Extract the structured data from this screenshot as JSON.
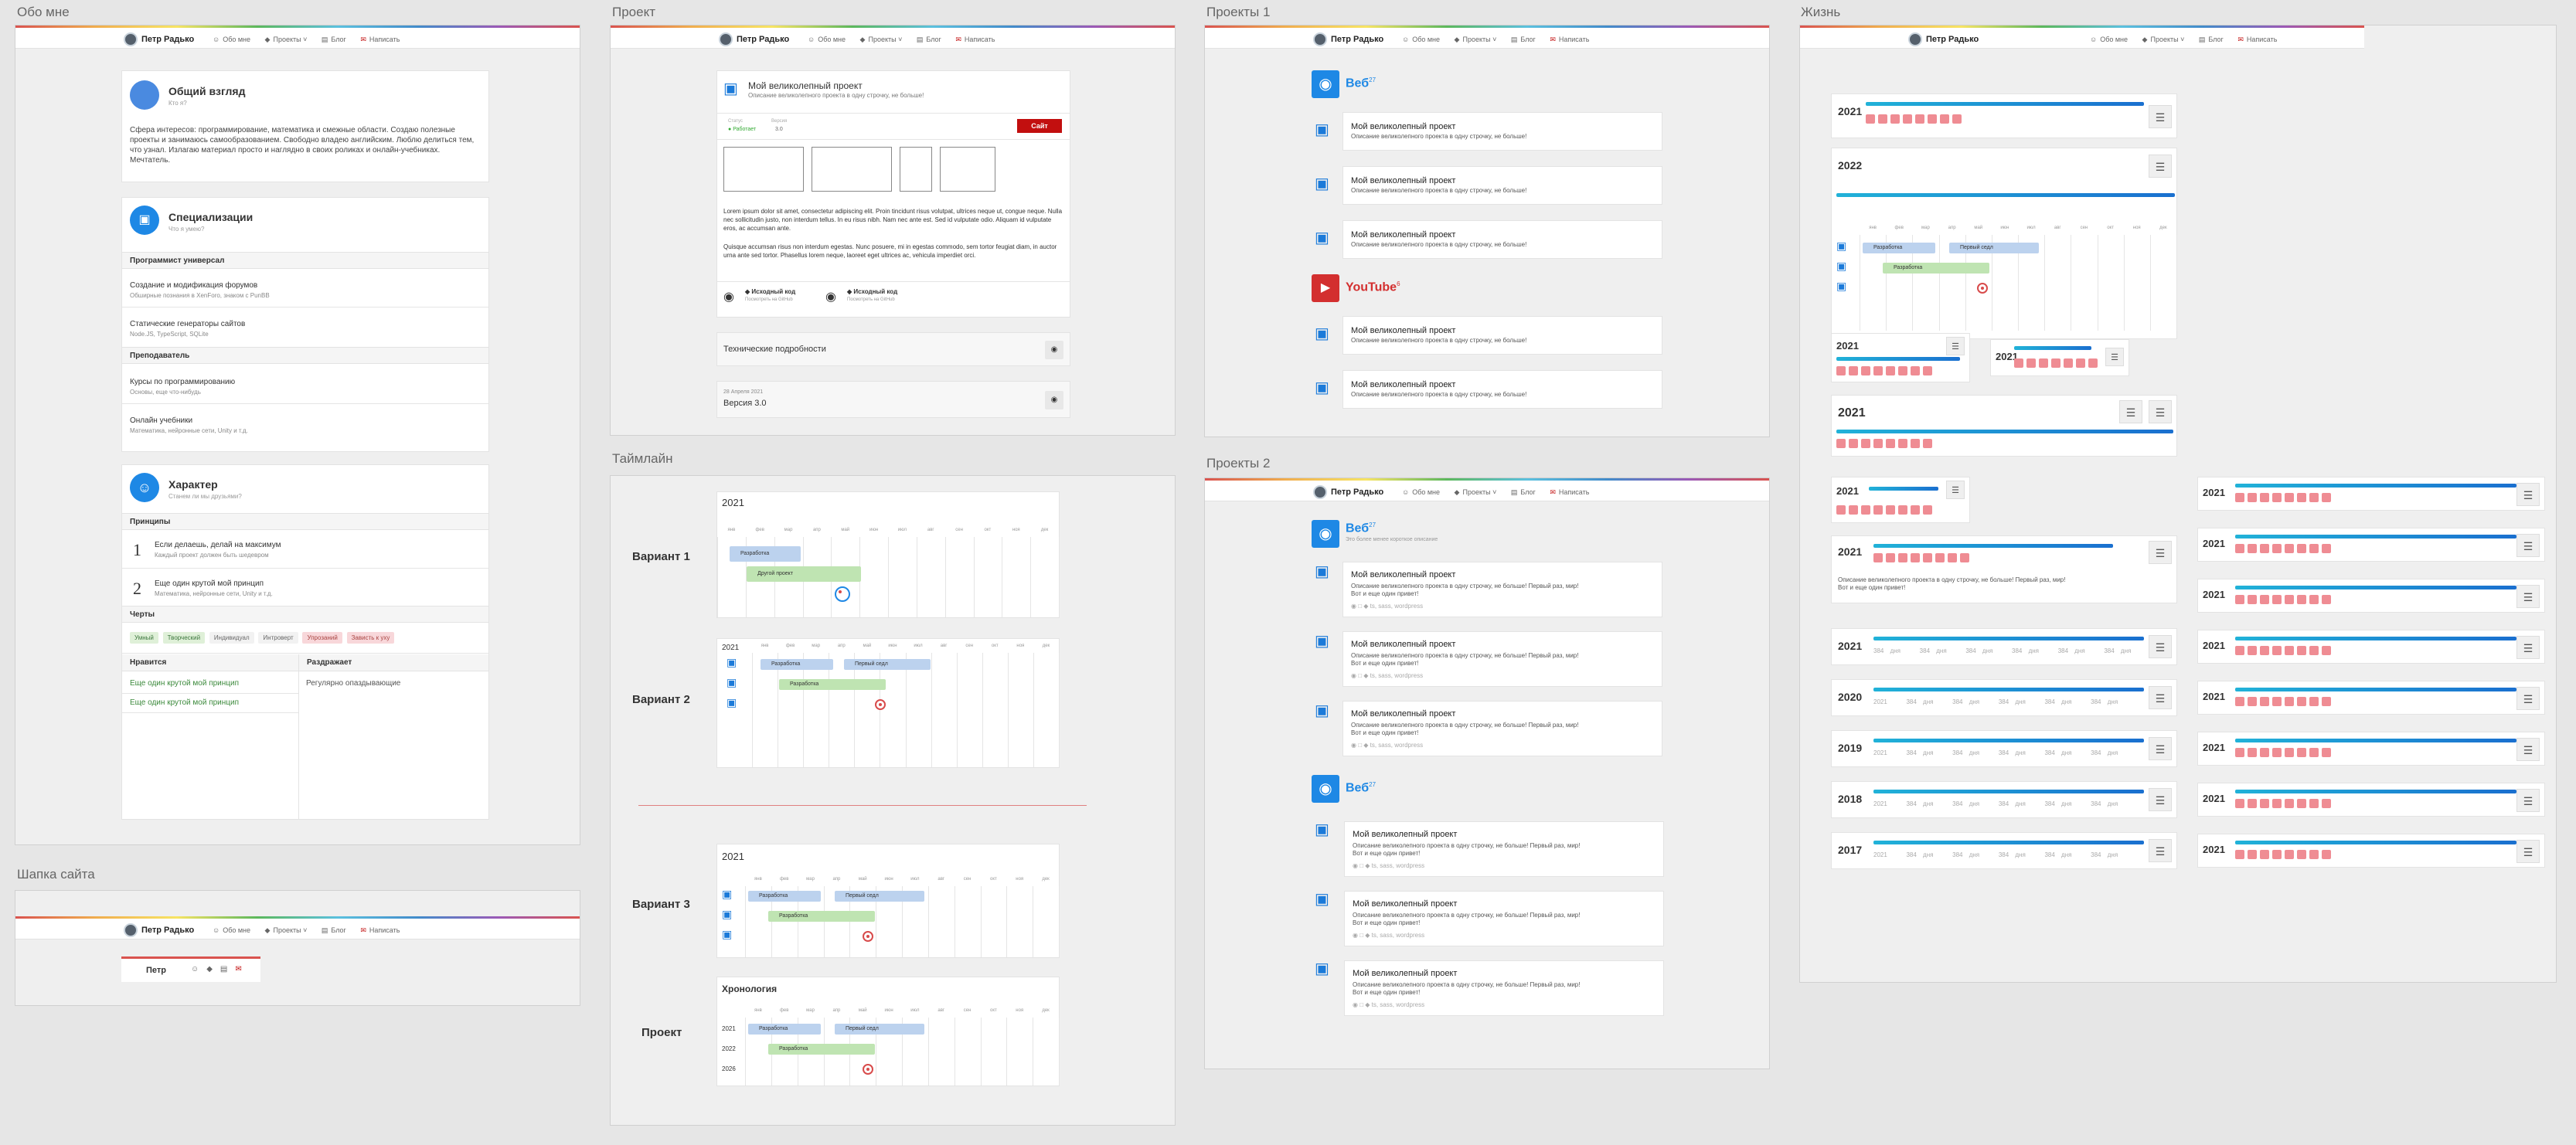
{
  "frames": {
    "about": "Обо мне",
    "header": "Шапка сайта",
    "project": "Проект",
    "timeline": "Таймлайн",
    "projects1": "Проекты 1",
    "projects2": "Проекты 2",
    "life": "Жизнь"
  },
  "site_header": {
    "name": "Петр Радько",
    "nav": [
      "Обо мне",
      "Проекты",
      "Блог",
      "Написать"
    ],
    "short_name": "Петр"
  },
  "about": {
    "overview": {
      "title": "Общий взгляд",
      "subtitle": "Кто я?",
      "text": "Сфера интересов: программирование, математика и смежные области. Создаю полезные проекты и занимаюсь самообразованием. Свободно владею английским. Люблю делиться тем, что узнал. Излагаю материал просто и наглядно в своих роликах и онлайн-учебниках. Мечтатель."
    },
    "spec": {
      "title": "Специализации",
      "subtitle": "Что я умею?",
      "group1": "Программист универсал",
      "items1": [
        {
          "t": "Создание и модификация форумов",
          "s": "Обширные познания в XenForo, знаком с PunBB"
        },
        {
          "t": "Статические генераторы сайтов",
          "s": "Node.JS, TypeScript, SQLite"
        }
      ],
      "group2": "Преподаватель",
      "items2": [
        {
          "t": "Курсы по программированию",
          "s": "Основы, еще что-нибудь"
        },
        {
          "t": "Онлайн учебники",
          "s": "Математика, нейронные сети, Unity и т.д."
        }
      ]
    },
    "character": {
      "title": "Характер",
      "subtitle": "Станем ли мы друзьями?",
      "principles_label": "Принципы",
      "principles": [
        {
          "n": "1",
          "t": "Если делаешь, делай на максимум",
          "s": "Каждый проект должен быть шедевром"
        },
        {
          "n": "2",
          "t": "Еще один крутой мой принцип",
          "s": "Математика, нейронные сети, Unity и т.д."
        }
      ],
      "traits_label": "Черты",
      "traits": [
        "Умный",
        "Творческий",
        "Индивидуал",
        "Интроверт",
        "Упрозаний",
        "Зависть к уху"
      ],
      "likes_label": "Нравится",
      "dislikes_label": "Раздражает",
      "likes": [
        "Еще один крутой мой принцип",
        "Еще один крутой мой принцип"
      ],
      "dislikes": [
        "Регулярно опаздывающие"
      ]
    }
  },
  "project": {
    "title": "Мой великолепный проект",
    "desc": "Описание великолепного проекта в одну строчку, не больше!",
    "status_label": "Статус",
    "status": "Работает",
    "version_label": "Версия",
    "version": "3.0",
    "site_btn": "Сайт",
    "body1": "Lorem ipsum dolor sit amet, consectetur adipiscing elit. Proin tincidunt risus volutpat, ultrices neque ut, congue neque. Nulla nec sollicitudin justo, non interdum tellus. In eu risus nibh. Nam nec ante est. Sed id vulputate odio. Aliquam id vulputate eros, ac accumsan ante.",
    "body2": "Quisque accumsan risus non interdum egestas. Nunc posuere, mi in egestas commodo, sem tortor feugiat diam, in auctor urna ante sed tortor. Phasellus lorem neque, laoreet eget ultrices ac, vehicula imperdiet orci.",
    "src_label": "Исходный код",
    "src_sub": "Посмотреть на GitHub",
    "tech": "Технические подробности",
    "date": "28 Апреля 2021",
    "version_title": "Версия 3.0"
  },
  "timeline": {
    "variants": [
      "Вариант 1",
      "Вариант 2",
      "Вариант 3",
      "Проект"
    ],
    "year": "2021",
    "months": [
      "янв",
      "фев",
      "мар",
      "апр",
      "май",
      "июн",
      "июл",
      "авг",
      "сен",
      "окт",
      "ноя",
      "дек"
    ],
    "bar1": "Разработка",
    "bar2": "Другой проект",
    "bar3": "Первый седл",
    "chronology": "Хронология",
    "years": [
      "2021",
      "2022",
      "2026"
    ]
  },
  "projects": {
    "web": "Веб",
    "web_count": "27",
    "youtube": "YouTube",
    "yt_count": "6",
    "web_sub": "Это более менее короткое описание",
    "item_title": "Мой великолепный проект",
    "item_desc": "Описание великолепного проекта в одну строчку, не больше!",
    "item_desc_long": "Описание великолепного проекта в одну строчку, не больше! Первый раз, мир!",
    "item_desc_long2": "Вот и еще один привет!",
    "item_meta": "ts, sass, wordpress"
  },
  "life": {
    "years_a": [
      "2021",
      "2022",
      "2021",
      "2021",
      "2021",
      "2021",
      "2021",
      "2021",
      "2020",
      "2019",
      "2018",
      "2017"
    ],
    "years_b": [
      "2021",
      "2021",
      "2021",
      "2021",
      "2021",
      "2021",
      "2021",
      "2021"
    ],
    "days": "384 дня",
    "desc": "Описание великолепного проекта в одну строчку, не больше! Первый раз, мир!",
    "desc2": "Вот и еще один привет!"
  },
  "colors": {
    "accent": "#1e88e5",
    "red": "#c20f0f",
    "pink": "#ef8c93"
  }
}
